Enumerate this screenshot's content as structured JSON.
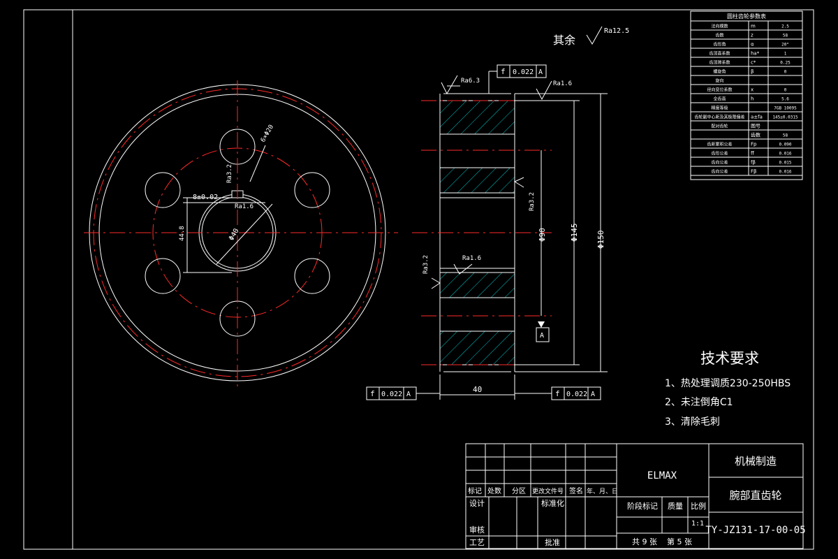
{
  "drawing": {
    "roughness_prefix": "其余",
    "roughness_default": "Ra12.5",
    "front_view": {
      "dim_bolt_circle": "6×Φ20",
      "dim_keyway_ra": "Ra3.2",
      "dim_key_width": "8±0.02",
      "dim_hole_ra": "Ra1.6",
      "dim_bore": "Φ40",
      "dim_key_depth": "44.8"
    },
    "section_view": {
      "ra_left_top": "Ra6.3",
      "ra_right_top": "Ra1.6",
      "ra_left_mid": "Ra3.2",
      "ra_bore": "Ra1.6",
      "ra_right_mid": "Ra3.2",
      "dim_bore_dia": "Φ90",
      "dim_hub_dia": "Φ145",
      "dim_outer_dia": "Φ150",
      "dim_width": "40",
      "datum_letter": "A",
      "tol_top": {
        "symbol": "f",
        "value": "0.022",
        "datum": "A"
      },
      "tol_left": {
        "symbol": "f",
        "value": "0.022",
        "datum": "A"
      },
      "tol_right": {
        "symbol": "f",
        "value": "0.022",
        "datum": "A"
      }
    }
  },
  "param_table": {
    "title": "圆柱齿轮参数表",
    "rows": [
      {
        "name": "法向模数",
        "sym": "m",
        "val": "2.5"
      },
      {
        "name": "齿数",
        "sym": "z",
        "val": "58"
      },
      {
        "name": "齿形角",
        "sym": "α",
        "val": "20°"
      },
      {
        "name": "齿顶高系数",
        "sym": "ha*",
        "val": "1"
      },
      {
        "name": "齿顶隙系数",
        "sym": "c*",
        "val": "0.25"
      },
      {
        "name": "螺旋角",
        "sym": "β",
        "val": "0"
      },
      {
        "name": "旋向",
        "sym": "",
        "val": ""
      },
      {
        "name": "径向变位系数",
        "sym": "x",
        "val": "0"
      },
      {
        "name": "全齿高",
        "sym": "h",
        "val": "5.6"
      },
      {
        "name": "精度等级",
        "sym": "",
        "val": "7GB 10095"
      },
      {
        "name": "齿轮副中心距及其极限偏差",
        "sym": "a±fa",
        "val": "145±0.0315"
      },
      {
        "name": "配对齿轮",
        "sym": "图号",
        "val": ""
      },
      {
        "name": "",
        "sym": "齿数",
        "val": "58"
      },
      {
        "name": "齿距累积公差",
        "sym": "Fp",
        "val": "0.090"
      },
      {
        "name": "齿形公差",
        "sym": "ff",
        "val": "0.016"
      },
      {
        "name": "齿向公差",
        "sym": "fβ",
        "val": "0.015"
      },
      {
        "name": "齿向公差",
        "sym": "Fβ",
        "val": "0.016"
      }
    ]
  },
  "requirements": {
    "title": "技术要求",
    "items": [
      "1、热处理调质230-250HBS",
      "2、未注倒角C1",
      "3、清除毛刺"
    ]
  },
  "title_block": {
    "headers": [
      "标记",
      "处数",
      "分区",
      "更改文件号",
      "签名",
      "年、月、日"
    ],
    "designer": "设计",
    "standardize": "标准化",
    "review": "审核",
    "process": "工艺",
    "approve": "批准",
    "stage_mark": "阶段标记",
    "weight": "质量",
    "scale_label": "比例",
    "scale": "1:1",
    "sheets": "共 9 张",
    "sheet_no": "第 5 张",
    "material": "ELMAX",
    "company": "机械制造",
    "part_name": "腕部直齿轮",
    "drawing_no": "TY-JZ131-17-00-05"
  },
  "colors": {
    "line": "#ffffff",
    "center": "#ff2a2a",
    "hatch": "#00c8c8",
    "bg": "#000000"
  }
}
